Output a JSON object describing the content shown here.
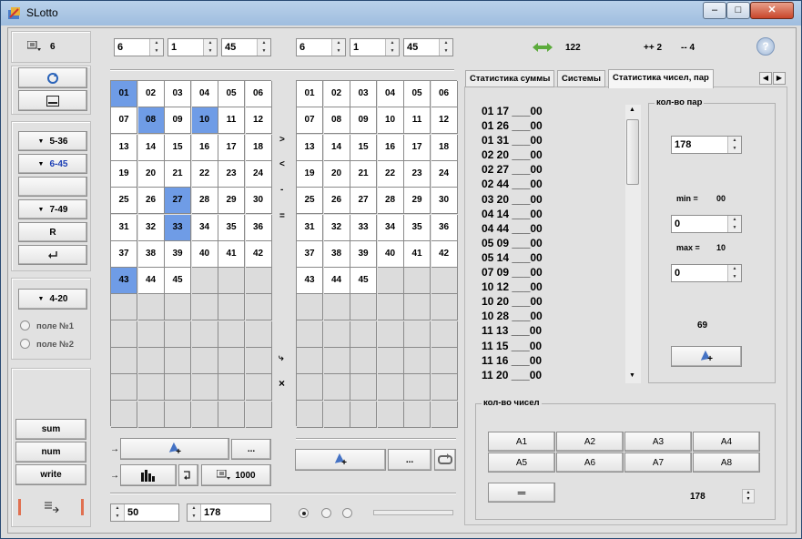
{
  "window": {
    "title": "SLotto",
    "minimize": "–",
    "maximize": "□",
    "close": "✕"
  },
  "left": {
    "count_value": "6",
    "game_buttons": [
      "5-36",
      "6-45",
      "",
      "7-49",
      "R"
    ],
    "game_42": "4-20",
    "radio1": "поле №1",
    "radio2": "поле №2",
    "sum": "sum",
    "num": "num",
    "write": "write"
  },
  "top": {
    "spin_a": [
      "6",
      "1",
      "45"
    ],
    "spin_b": [
      "6",
      "1",
      "45"
    ],
    "arrow_value": "122",
    "plus_value": "++ 2",
    "minus_value": "-- 4",
    "help": "?"
  },
  "grid_left": {
    "numbers": [
      "01",
      "02",
      "03",
      "04",
      "05",
      "06",
      "07",
      "08",
      "09",
      "10",
      "11",
      "12",
      "13",
      "14",
      "15",
      "16",
      "17",
      "18",
      "19",
      "20",
      "21",
      "22",
      "23",
      "24",
      "25",
      "26",
      "27",
      "28",
      "29",
      "30",
      "31",
      "32",
      "33",
      "34",
      "35",
      "36",
      "37",
      "38",
      "39",
      "40",
      "41",
      "42",
      "43",
      "44",
      "45"
    ],
    "selected": [
      "01",
      "08",
      "10",
      "27",
      "33",
      "43"
    ]
  },
  "grid_right": {
    "numbers": [
      "01",
      "02",
      "03",
      "04",
      "05",
      "06",
      "07",
      "08",
      "09",
      "10",
      "11",
      "12",
      "13",
      "14",
      "15",
      "16",
      "17",
      "18",
      "19",
      "20",
      "21",
      "22",
      "23",
      "24",
      "25",
      "26",
      "27",
      "28",
      "29",
      "30",
      "31",
      "32",
      "33",
      "34",
      "35",
      "36",
      "37",
      "38",
      "39",
      "40",
      "41",
      "42",
      "43",
      "44",
      "45"
    ]
  },
  "middle_symbols": [
    ">",
    "<",
    "-",
    "=",
    "⤷",
    "×"
  ],
  "bottom": {
    "dots": "...",
    "dots2": "...",
    "count_1000": "1000",
    "spin_50": "50",
    "spin_178": "178"
  },
  "tabs": [
    "Статистика суммы",
    "Системы",
    "Статистика чисел, пар"
  ],
  "pairs": [
    "01 17 ___00",
    "01 26 ___00",
    "01 31 ___00",
    "02 20 ___00",
    "02 27 ___00",
    "02 44 ___00",
    "03 20 ___00",
    "04 14 ___00",
    "04 44 ___00",
    "05 09 ___00",
    "05 14 ___00",
    "07 09 ___00",
    "10 12 ___00",
    "10 20 ___00",
    "10 28 ___00",
    "11 13 ___00",
    "11 15 ___00",
    "11 16 ___00",
    "11 20 ___00"
  ],
  "pairs_box": {
    "caption": "кол-во пар",
    "spin_178": "178",
    "min_label": "min =",
    "min_value": "00",
    "spin_min": "0",
    "max_label": "max =",
    "max_value": "10",
    "spin_max": "0",
    "result": "69"
  },
  "nums_box": {
    "caption": "кол-во чисел",
    "buttons": [
      "A1",
      "A2",
      "A3",
      "A4",
      "A5",
      "A6",
      "A7",
      "A8"
    ],
    "eq": "═",
    "spin_178": "178"
  }
}
